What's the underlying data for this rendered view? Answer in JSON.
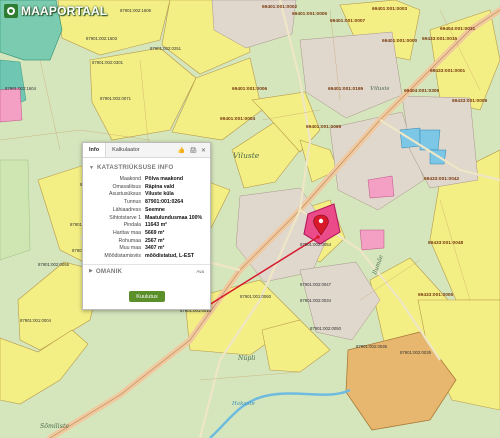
{
  "app": {
    "logo_text": "MAAPORTAAL"
  },
  "popup": {
    "tabs": [
      {
        "label": "Info"
      },
      {
        "label": "Kalkulaator"
      }
    ],
    "tool_icons": [
      "thumbs-up-icon",
      "print-icon",
      "close-icon"
    ],
    "section_title": "KATASTRIÜKSUSE INFO",
    "rows": [
      {
        "key": "Maakond",
        "value": "Põlva maakond"
      },
      {
        "key": "Omavalitsus",
        "value": "Räpina vald"
      },
      {
        "key": "Asustusüksus",
        "value": "Viluste küla"
      },
      {
        "key": "Tunnus",
        "value": "87901:001:0264"
      },
      {
        "key": "Lähiaadress",
        "value": "Seemne"
      },
      {
        "key": "Sihtotstarve 1",
        "value": "Maatulundusmaa 100%"
      },
      {
        "key": "Pindala",
        "value": "11643 m²"
      },
      {
        "key": "Haritav maa",
        "value": "5669 m²"
      },
      {
        "key": "Rohumaa",
        "value": "2567 m²"
      },
      {
        "key": "Muu maa",
        "value": "3407 m²"
      },
      {
        "key": "Mõõdistamisviis",
        "value": "mõõdistatud, L-EST"
      }
    ],
    "owner_title": "OMANIK",
    "owner_link": "Ava",
    "close_button": "Kuulutus"
  },
  "map": {
    "place_labels": [
      "Viluste",
      "Vilusis",
      "Nüpli",
      "Ilumäe",
      "Sõmiliste",
      "Hakaste"
    ],
    "parcel_labels": [
      "69401:001:0005",
      "69401:001:0007",
      "69401:001:0002",
      "69401:001:0195",
      "69401:001:0003",
      "69401:001:0000",
      "69401:001:0065",
      "69401:001:0004",
      "69401:001:0006",
      "69404:001:0305",
      "69404:001:0031",
      "69433:001:0015",
      "69433:001:0001",
      "69433:001:0008",
      "69433:001:0042",
      "69433:001:0048",
      "69433:001:0005",
      "87901:002:1603",
      "87901:002:0071",
      "87901:002:0301",
      "87901:002:1606",
      "87901:002:1604",
      "87901:002:0251",
      "87901:002:0202",
      "87901:002:0045",
      "87901:002:0042",
      "87901:002:0022",
      "87901:002:0055",
      "87901:001:0004",
      "87901:001:0010",
      "87901:001:0060",
      "87901:002:0054",
      "87901:002:0047",
      "87901:002:0034",
      "87901:002:0050",
      "87901:002:0036",
      "87901:002:0035"
    ],
    "colors": {
      "agricultural": "#f2ee7c",
      "forest": "#cfe3a9",
      "residential": "#d9d2cc",
      "selected": "#ec4b8a",
      "road": "#f3c9a0",
      "water": "#7cc6e6",
      "marker": "#d7192b"
    }
  }
}
